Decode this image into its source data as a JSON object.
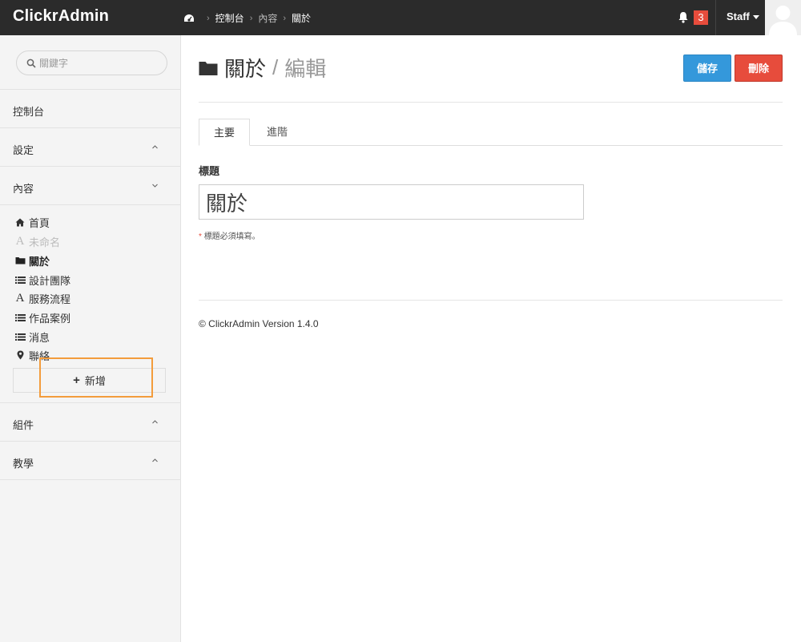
{
  "topbar": {
    "brand": "ClickrAdmin",
    "breadcrumb": [
      {
        "label": "控制台"
      },
      {
        "label": "內容"
      },
      {
        "label": "關於"
      }
    ],
    "notification_count": "3",
    "user_label": "Staff"
  },
  "sidebar": {
    "search_placeholder": "關鍵字",
    "dashboard": "控制台",
    "settings": "設定",
    "content": "內容",
    "content_items": [
      {
        "label": "首頁",
        "icon": "home-icon"
      },
      {
        "label": "未命名",
        "icon": "font-icon"
      },
      {
        "label": "關於",
        "icon": "folder-icon"
      },
      {
        "label": "設計團隊",
        "icon": "list-icon"
      },
      {
        "label": "服務流程",
        "icon": "font-icon"
      },
      {
        "label": "作品案例",
        "icon": "list-icon"
      },
      {
        "label": "消息",
        "icon": "list-icon"
      },
      {
        "label": "聯絡",
        "icon": "map-marker-icon"
      }
    ],
    "add_label": "新增",
    "components": "組件",
    "tutorial": "教學"
  },
  "main": {
    "title": "關於",
    "subtitle": "編輯",
    "save_label": "儲存",
    "delete_label": "刪除",
    "tabs": [
      {
        "label": "主要"
      },
      {
        "label": "進階"
      }
    ],
    "field_label": "標題",
    "field_value": "關於",
    "hint_star": "*",
    "hint_text": "標題必須填寫。",
    "footer": "© ClickrAdmin Version 1.4.0"
  },
  "colors": {
    "topbar": "#2b2b2b",
    "save": "#3498db",
    "delete": "#e74c3c",
    "highlight": "#f39c3c"
  }
}
